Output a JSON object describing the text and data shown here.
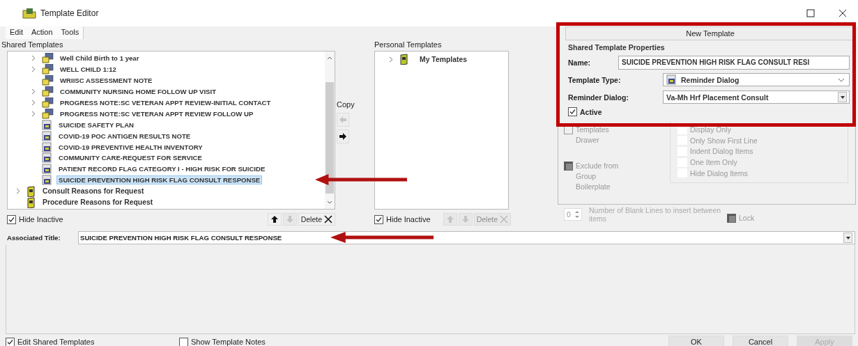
{
  "window": {
    "title": "Template Editor"
  },
  "menu": [
    "Edit",
    "Action",
    "Tools"
  ],
  "shared_templates": {
    "label": "Shared Templates",
    "items": [
      {
        "label": "Well Child Birth to 1 year",
        "kind": "group",
        "expander": true,
        "selected": false
      },
      {
        "label": "WELL CHILD 1:12",
        "kind": "group",
        "expander": true,
        "selected": false
      },
      {
        "label": "WRIISC ASSESSMENT NOTE",
        "kind": "group",
        "expander": false,
        "selected": false
      },
      {
        "label": "COMMUNITY NURSING HOME FOLLOW UP VISIT",
        "kind": "group",
        "expander": true,
        "selected": false
      },
      {
        "label": "PROGRESS NOTE:SC VETERAN APPT REVIEW-INITIAL CONTACT",
        "kind": "group",
        "expander": true,
        "selected": false
      },
      {
        "label": "PROGRESS NOTE:SC VETERAN APPT REVIEW FOLLOW UP",
        "kind": "group",
        "expander": true,
        "selected": false
      },
      {
        "label": "SUICIDE SAFETY PLAN",
        "kind": "template",
        "expander": false,
        "selected": false
      },
      {
        "label": "COVID-19 POC ANTIGEN RESULTS NOTE",
        "kind": "template",
        "expander": false,
        "selected": false
      },
      {
        "label": "COVID-19 PREVENTIVE HEALTH INVENTORY",
        "kind": "template",
        "expander": false,
        "selected": false
      },
      {
        "label": "COMMUNITY CARE-REQUEST FOR SERVICE",
        "kind": "template",
        "expander": false,
        "selected": false
      },
      {
        "label": "PATIENT RECORD FLAG CATEGORY I - HIGH RISK FOR SUICIDE",
        "kind": "template",
        "expander": false,
        "selected": false
      },
      {
        "label": "SUICIDE PREVENTION HIGH RISK FLAG CONSULT RESPONSE",
        "kind": "template",
        "expander": false,
        "selected": true
      },
      {
        "label": "Consult Reasons for Request",
        "kind": "reasons",
        "expander": true,
        "selected": false
      },
      {
        "label": "Procedure Reasons for Request",
        "kind": "reasons",
        "expander": false,
        "selected": false
      }
    ],
    "hide_inactive": {
      "label": "Hide Inactive",
      "checked": true
    },
    "buttons": [
      {
        "kind": "up",
        "disabled": false
      },
      {
        "kind": "down",
        "disabled": true
      },
      {
        "kind": "delete",
        "label": "Delete",
        "disabled": false
      }
    ]
  },
  "copy": {
    "label": "Copy",
    "buttons": [
      {
        "kind": "left",
        "disabled": true
      },
      {
        "kind": "right",
        "disabled": false
      }
    ]
  },
  "personal_templates": {
    "label": "Personal Templates",
    "items": [
      {
        "label": "My Templates",
        "kind": "root",
        "expander": true,
        "selected": false
      }
    ],
    "hide_inactive": {
      "label": "Hide Inactive",
      "checked": true
    },
    "buttons": [
      {
        "kind": "up",
        "disabled": true
      },
      {
        "kind": "down",
        "disabled": true
      },
      {
        "kind": "delete",
        "label": "Delete",
        "disabled": true
      }
    ]
  },
  "properties": {
    "header": "New Template",
    "section": "Shared Template Properties",
    "name": {
      "label": "Name:",
      "value": "SUICIDE PREVENTION HIGH RISK FLAG CONSULT RESI"
    },
    "template_type": {
      "label": "Template Type:",
      "value": "Reminder Dialog"
    },
    "reminder_dialog": {
      "label": "Reminder Dialog:",
      "value": "Va-Mh Hrf Placement Consult"
    },
    "active": {
      "label": "Active",
      "checked": true
    },
    "options": [
      {
        "label": "Templates Drawer",
        "checked": false,
        "disabled": true
      },
      {
        "label": "Exclude from Group Boilerplate",
        "checked": true,
        "disabled": true
      }
    ],
    "dialog_properties": [
      {
        "label": "Display Only",
        "checked": false,
        "disabled": true
      },
      {
        "label": "Only Show First Line",
        "checked": false,
        "disabled": true
      },
      {
        "label": "Indent Dialog Items",
        "checked": false,
        "disabled": true
      },
      {
        "label": "One Item Only",
        "checked": false,
        "disabled": true
      },
      {
        "label": "Hide Dialog Items",
        "checked": false,
        "disabled": true
      }
    ],
    "blank_lines": {
      "value": "0",
      "label": "Number of Blank Lines to insert between items"
    },
    "lock": {
      "label": "Lock",
      "checked": true,
      "disabled": true
    }
  },
  "associated_title": {
    "label": "Associated Title:",
    "value": "SUICIDE PREVENTION HIGH RISK FLAG CONSULT RESPONSE"
  },
  "footer": {
    "checkboxes": [
      {
        "label": "Edit Shared Templates",
        "checked": true
      },
      {
        "label": "Show Template Notes",
        "checked": false
      }
    ],
    "buttons": [
      {
        "label": "OK",
        "disabled": false
      },
      {
        "label": "Cancel",
        "disabled": false
      },
      {
        "label": "Apply",
        "disabled": true
      }
    ]
  },
  "annotations": [
    {
      "kind": "box"
    },
    {
      "kind": "arrow"
    },
    {
      "kind": "arrow"
    }
  ]
}
